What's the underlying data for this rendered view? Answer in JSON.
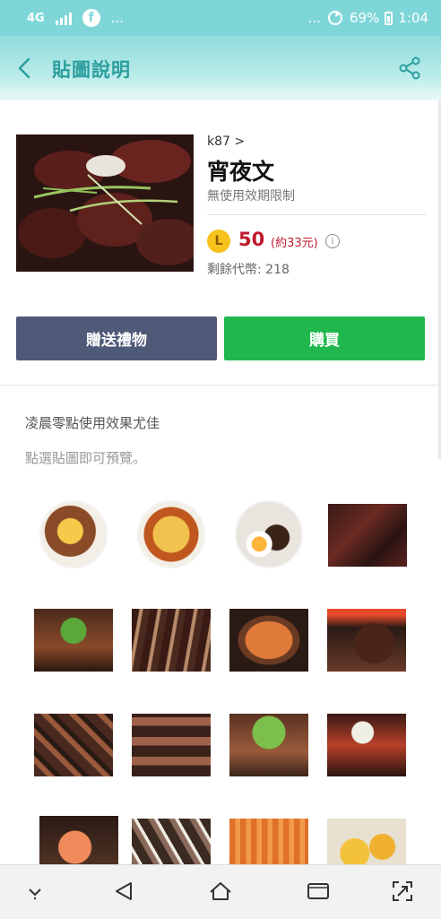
{
  "status_bar": {
    "network": "4G",
    "time": "1:04",
    "battery": "69%",
    "dots_left": "...",
    "dots_right": "..."
  },
  "header": {
    "title": "貼圖說明",
    "icons": [
      "back-icon",
      "share-icon"
    ]
  },
  "product": {
    "author": "k87 >",
    "name": "宵夜文",
    "validity": "無使用效期限制",
    "coin_label": "L",
    "price": "50",
    "price_note": "(約33元)",
    "info": "i",
    "coins_left": "剩餘代幣: 218"
  },
  "buttons": {
    "gift": "贈送禮物",
    "buy": "購買"
  },
  "notes": {
    "line1": "凌晨零點使用效果尤佳",
    "line2": "點選貼圖即可預覽。"
  },
  "colors": {
    "accent": "#2c9e9e",
    "header_bg": "#8fdcdc",
    "price": "#c0192c",
    "buy": "#21b74f",
    "gift": "#4f5a78"
  },
  "nav": [
    "expand-icon",
    "back-nav-icon",
    "home-icon",
    "recents-icon",
    "screenshot-icon"
  ]
}
